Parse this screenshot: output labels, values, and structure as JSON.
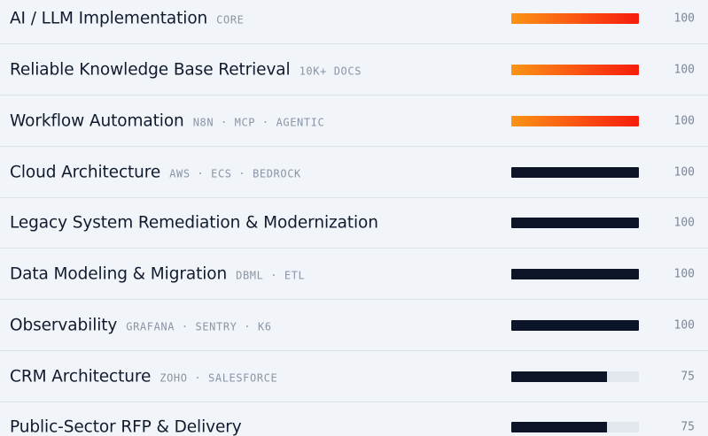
{
  "skills": [
    {
      "name": "AI / LLM Implementation",
      "tags": "CORE",
      "value": "100",
      "level": 1.0,
      "accent": "hot"
    },
    {
      "name": "Reliable Knowledge Base Retrieval",
      "tags": "10K+ DOCS",
      "value": "100",
      "level": 1.0,
      "accent": "hot"
    },
    {
      "name": "Workflow Automation",
      "tags": "N8N · MCP · AGENTIC",
      "value": "100",
      "level": 1.0,
      "accent": "hot"
    },
    {
      "name": "Cloud Architecture",
      "tags": "AWS · ECS · BEDROCK",
      "value": "100",
      "level": 1.0,
      "accent": "dark"
    },
    {
      "name": "Legacy System Remediation & Modernization",
      "tags": "",
      "value": "100",
      "level": 1.0,
      "accent": "dark"
    },
    {
      "name": "Data Modeling & Migration",
      "tags": "DBML · ETL",
      "value": "100",
      "level": 1.0,
      "accent": "dark"
    },
    {
      "name": "Observability",
      "tags": "GRAFANA · SENTRY · K6",
      "value": "100",
      "level": 1.0,
      "accent": "dark"
    },
    {
      "name": "CRM Architecture",
      "tags": "ZOHO · SALESFORCE",
      "value": "75",
      "level": 0.75,
      "accent": "dark"
    },
    {
      "name": "Public-Sector RFP & Delivery",
      "tags": "",
      "value": "75",
      "level": 0.75,
      "accent": "dark"
    }
  ],
  "colors": {
    "background": "#f1f4f8",
    "text": "#111b2e",
    "tag": "#8a95a6",
    "bar_dark": "#0c1428",
    "bar_track": "#e2e7ee",
    "bar_hot_start": "#fa9415",
    "bar_hot_end": "#f61d0c"
  }
}
